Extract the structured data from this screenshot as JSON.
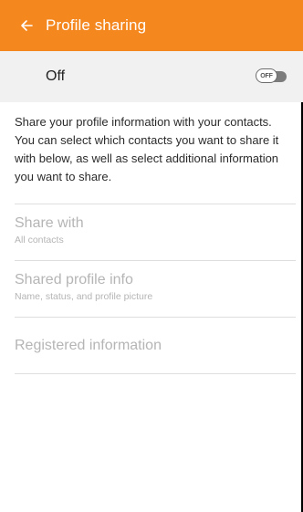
{
  "header": {
    "title": "Profile sharing",
    "accent_color": "#f5871f",
    "back_icon": "arrow-left-icon"
  },
  "master_switch": {
    "label": "Off",
    "toggle_text": "OFF",
    "state": "off"
  },
  "description": "Share your profile information with your contacts. You can select which contacts you want to share it with below, as well as select additional information you want to share.",
  "settings": [
    {
      "title": "Share with",
      "subtitle": "All contacts"
    },
    {
      "title": "Shared profile info",
      "subtitle": "Name, status, and profile picture"
    },
    {
      "title": "Registered information"
    }
  ]
}
